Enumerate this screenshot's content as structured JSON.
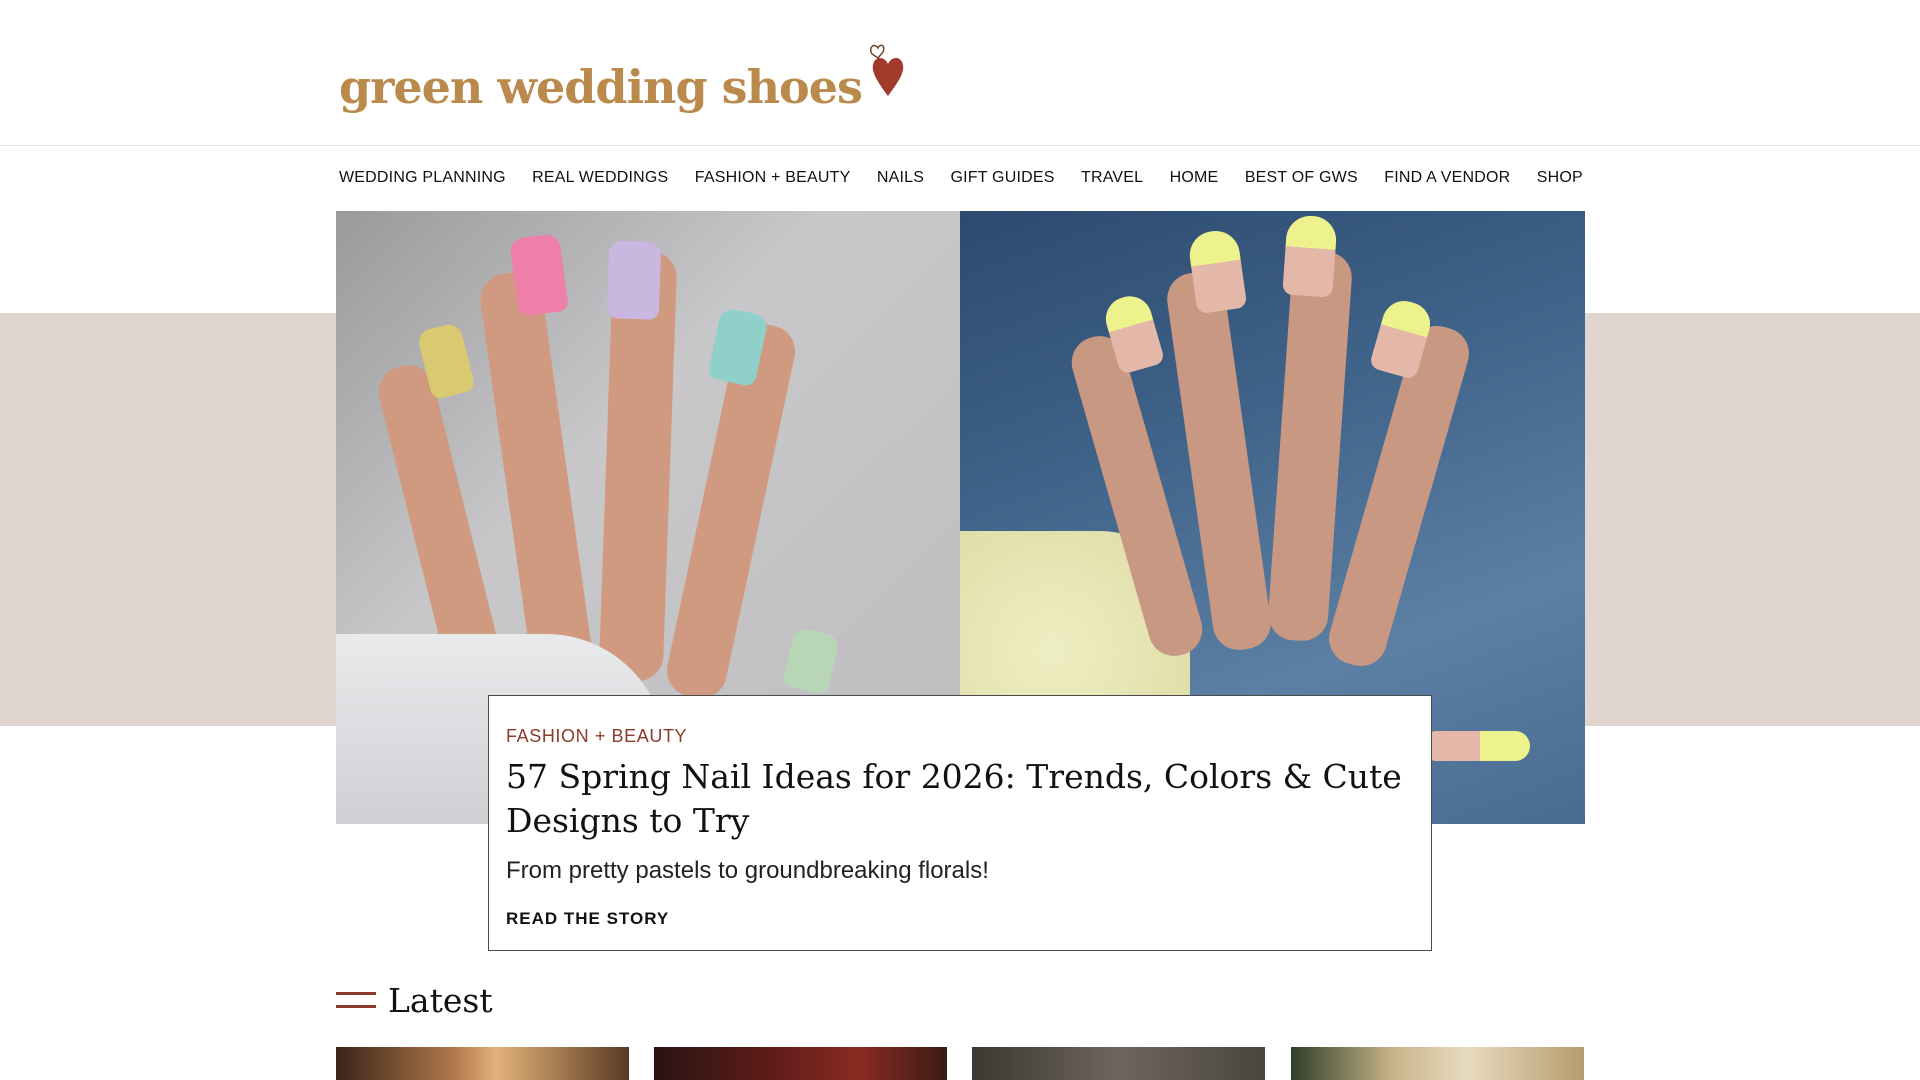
{
  "brand": {
    "name": "green wedding shoes",
    "logo_color": "#b98a4b",
    "heart_color": "#a23a2b"
  },
  "nav": {
    "items": [
      {
        "label": "WEDDING PLANNING"
      },
      {
        "label": "REAL WEDDINGS"
      },
      {
        "label": "FASHION + BEAUTY"
      },
      {
        "label": "NAILS"
      },
      {
        "label": "GIFT GUIDES"
      },
      {
        "label": "TRAVEL"
      },
      {
        "label": "HOME"
      },
      {
        "label": "BEST OF GWS"
      },
      {
        "label": "FIND A VENDOR"
      },
      {
        "label": "SHOP"
      }
    ]
  },
  "hero": {
    "category": "FASHION + BEAUTY",
    "title": "57 Spring Nail Ideas for 2026: Trends, Colors & Cute Designs to Try",
    "subtitle": "From pretty pastels to groundbreaking florals!",
    "cta": "READ THE STORY",
    "band_color": "#e0d5cf",
    "accent_color": "#8c3b2b"
  },
  "latest": {
    "heading": "Latest",
    "thumbnails": [
      {
        "icon": "photo-thumbnail"
      },
      {
        "icon": "photo-thumbnail"
      },
      {
        "icon": "photo-thumbnail"
      },
      {
        "icon": "photo-thumbnail"
      }
    ]
  }
}
